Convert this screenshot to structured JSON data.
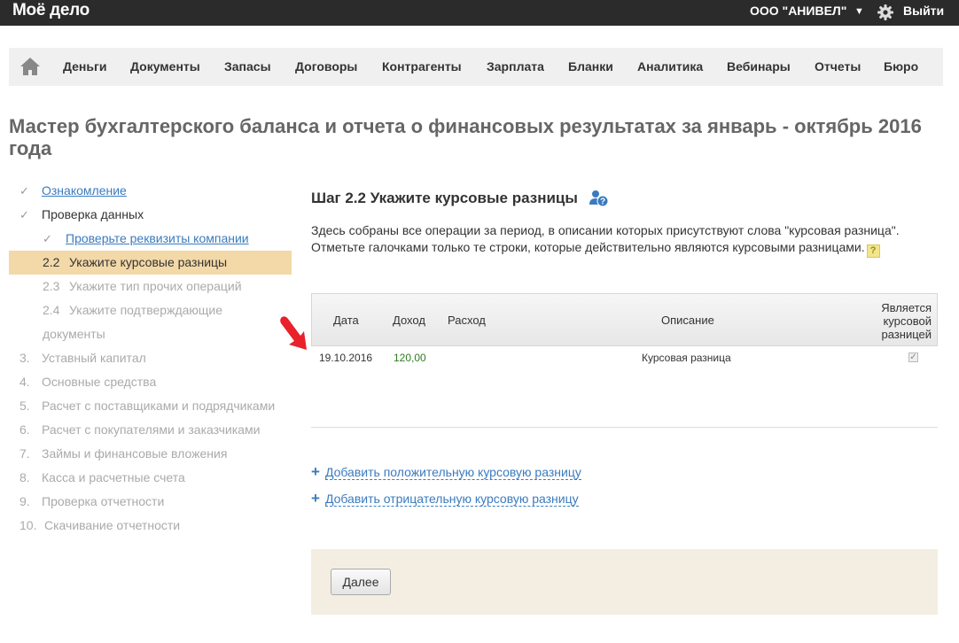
{
  "header": {
    "logo": "Моё дело",
    "company": "ООО \"АНИВЕЛ\"",
    "caret": "▼",
    "logout": "Выйти"
  },
  "nav": {
    "items": [
      "Деньги",
      "Документы",
      "Запасы",
      "Договоры",
      "Контрагенты",
      "Зарплата",
      "Бланки",
      "Аналитика",
      "Вебинары",
      "Отчеты",
      "Бюро"
    ]
  },
  "page_title": "Мастер бухгалтерского баланса и отчета о финансовых результатах за январь - октябрь 2016 года",
  "steps": {
    "check": "✓",
    "s1": "Ознакомление",
    "s2": "Проверка данных",
    "s21": "Проверьте реквизиты компании",
    "s22_num": "2.2",
    "s22": "Укажите курсовые разницы",
    "s23_num": "2.3",
    "s23": "Укажите тип прочих операций",
    "s24_num": "2.4",
    "s24a": "Укажите подтверждающие",
    "s24b": "документы",
    "s3_num": "3.",
    "s3": "Уставный капитал",
    "s4_num": "4.",
    "s4": "Основные средства",
    "s5_num": "5.",
    "s5": "Расчет с поставщиками и подрядчиками",
    "s6_num": "6.",
    "s6": "Расчет с покупателями и заказчиками",
    "s7_num": "7.",
    "s7": "Займы и финансовые вложения",
    "s8_num": "8.",
    "s8": "Касса и расчетные счета",
    "s9_num": "9.",
    "s9": "Проверка отчетности",
    "s10_num": "10.",
    "s10": "Скачивание отчетности"
  },
  "main": {
    "step_title": "Шаг 2.2 Укажите курсовые разницы",
    "desc_line1": "Здесь собраны все операции за период, в описании которых присутствуют слова \"курсовая разница\".",
    "desc_line2": "Отметьте галочками только те строки, которые действительно являются курсовыми разницами.",
    "help_mark": "?",
    "table": {
      "headers": {
        "date": "Дата",
        "income": "Доход",
        "expense": "Расход",
        "description": "Описание",
        "is_fx_1": "Является",
        "is_fx_2": "курсовой",
        "is_fx_3": "разницей"
      },
      "rows": [
        {
          "date": "19.10.2016",
          "income": "120,00",
          "expense": "",
          "description": "Курсовая разница",
          "checked": "✓"
        }
      ]
    },
    "add_positive": "Добавить положительную курсовую разницу",
    "add_negative": "Добавить отрицательную курсовую разницу",
    "plus": "+",
    "next_button": "Далее"
  },
  "colors": {
    "topbar": "#2b2b2b",
    "active_step": "#f3d8a8",
    "link": "#3a7bbf",
    "income": "#2e7d1e",
    "footer": "#f4eee2",
    "arrow": "#e8212b"
  }
}
